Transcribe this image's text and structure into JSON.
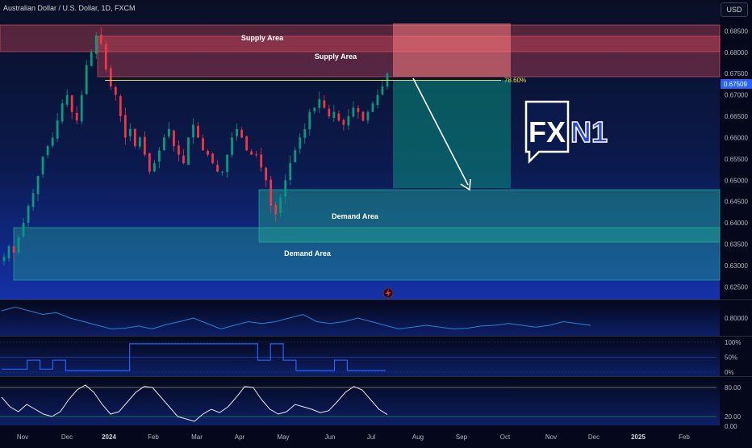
{
  "header": {
    "title": "Australian Dollar / U.S. Dollar, 1D, FXCM",
    "currency_button": "USD"
  },
  "logo": {
    "text_fx": "FX",
    "text_n1": "N1"
  },
  "colors": {
    "up": "#089981",
    "down": "#f23645",
    "supply": "#f7525f",
    "demand": "#22ab94",
    "fib": "#e6e13a",
    "price_badge": "#2962ff",
    "indicator_line": "#2f7fd4"
  },
  "zones": {
    "supply_outer_label": "Supply Area",
    "supply_inner_label": "Supply Area",
    "demand_inner_label": "Demand Area",
    "demand_outer_label": "Demand Area"
  },
  "fib_label": "78.60%",
  "current_price": "0.67509",
  "chart_data": [
    {
      "type": "candlestick",
      "title": "Australian Dollar / U.S. Dollar, 1D, FXCM",
      "x_tick_labels": [
        "Nov",
        "Dec",
        "2024",
        "Feb",
        "Mar",
        "Apr",
        "May",
        "Jun",
        "Jul",
        "Aug",
        "Sep",
        "Oct",
        "Nov",
        "Dec",
        "2025",
        "Feb"
      ],
      "y_tick_labels": [
        "0.69000",
        "0.68500",
        "0.68000",
        "0.67500",
        "0.67000",
        "0.66500",
        "0.66000",
        "0.65500",
        "0.65000",
        "0.64500",
        "0.64000",
        "0.63500",
        "0.63000",
        "0.62500"
      ],
      "ylim": [
        0.6245,
        0.6915
      ],
      "price_path": [
        [
          0.632,
          0.6345,
          0.633,
          0.6365,
          0.64,
          0.644,
          0.647,
          0.651,
          0.6555,
          0.658,
          0.66,
          0.664,
          0.668,
          0.67,
          0.666,
          0.664,
          0.67,
          0.677,
          0.68,
          0.684,
          0.682,
          0.676
        ],
        [
          0.672,
          0.67,
          0.665,
          0.66,
          0.662,
          0.658,
          0.66,
          0.656,
          0.652,
          0.654,
          0.657,
          0.66,
          0.662,
          0.658,
          0.656,
          0.654,
          0.66,
          0.663,
          0.66,
          0.657
        ],
        [
          0.656,
          0.654,
          0.652,
          0.652,
          0.656,
          0.66,
          0.662,
          0.66,
          0.657,
          0.656,
          0.656,
          0.653,
          0.65,
          0.644,
          0.642,
          0.646,
          0.65,
          0.654,
          0.657,
          0.66
        ],
        [
          0.662,
          0.666,
          0.667,
          0.669,
          0.667,
          0.665,
          0.666,
          0.664,
          0.663,
          0.665,
          0.667,
          0.666,
          0.664,
          0.666,
          0.668,
          0.67,
          0.672,
          0.675
        ]
      ],
      "current_price": 0.67509,
      "fib_level": 0.6765
    },
    {
      "type": "line",
      "title": "",
      "y_tick_labels": [
        "0.80000"
      ],
      "values": [
        0.82,
        0.83,
        0.82,
        0.81,
        0.815,
        0.8,
        0.79,
        0.78,
        0.77,
        0.772,
        0.778,
        0.77,
        0.782,
        0.79,
        0.8,
        0.785,
        0.77,
        0.78,
        0.79,
        0.785,
        0.79,
        0.8,
        0.81,
        0.79,
        0.785,
        0.79,
        0.8,
        0.79,
        0.78,
        0.77,
        0.775,
        0.78,
        0.775,
        0.77,
        0.772,
        0.778,
        0.78,
        0.785,
        0.78,
        0.775,
        0.78,
        0.79,
        0.785,
        0.78
      ]
    },
    {
      "type": "line",
      "title": "",
      "y_tick_labels": [
        "100%",
        "50%",
        "0%"
      ],
      "values": [
        0.1,
        0.1,
        0.4,
        0.1,
        0.4,
        0.05,
        0.05,
        0.05,
        0.05,
        0.05,
        0.95,
        0.95,
        0.95,
        0.95,
        0.95,
        0.95,
        0.95,
        0.95,
        0.95,
        0.95,
        0.4,
        0.95,
        0.4,
        0.05,
        0.05,
        0.05,
        0.4,
        0.05,
        0.05,
        0.05,
        0.05
      ]
    },
    {
      "type": "line",
      "title": "",
      "y_tick_labels": [
        "80.00",
        "20.00",
        "0.00"
      ],
      "ylim": [
        0,
        100
      ],
      "values": [
        60,
        40,
        30,
        45,
        35,
        25,
        20,
        30,
        55,
        75,
        85,
        70,
        45,
        25,
        30,
        50,
        70,
        82,
        80,
        60,
        40,
        20,
        15,
        10,
        25,
        35,
        28,
        40,
        60,
        82,
        80,
        55,
        35,
        25,
        30,
        45,
        40,
        35,
        28,
        32,
        50,
        70,
        82,
        75,
        55,
        35,
        24
      ]
    }
  ]
}
